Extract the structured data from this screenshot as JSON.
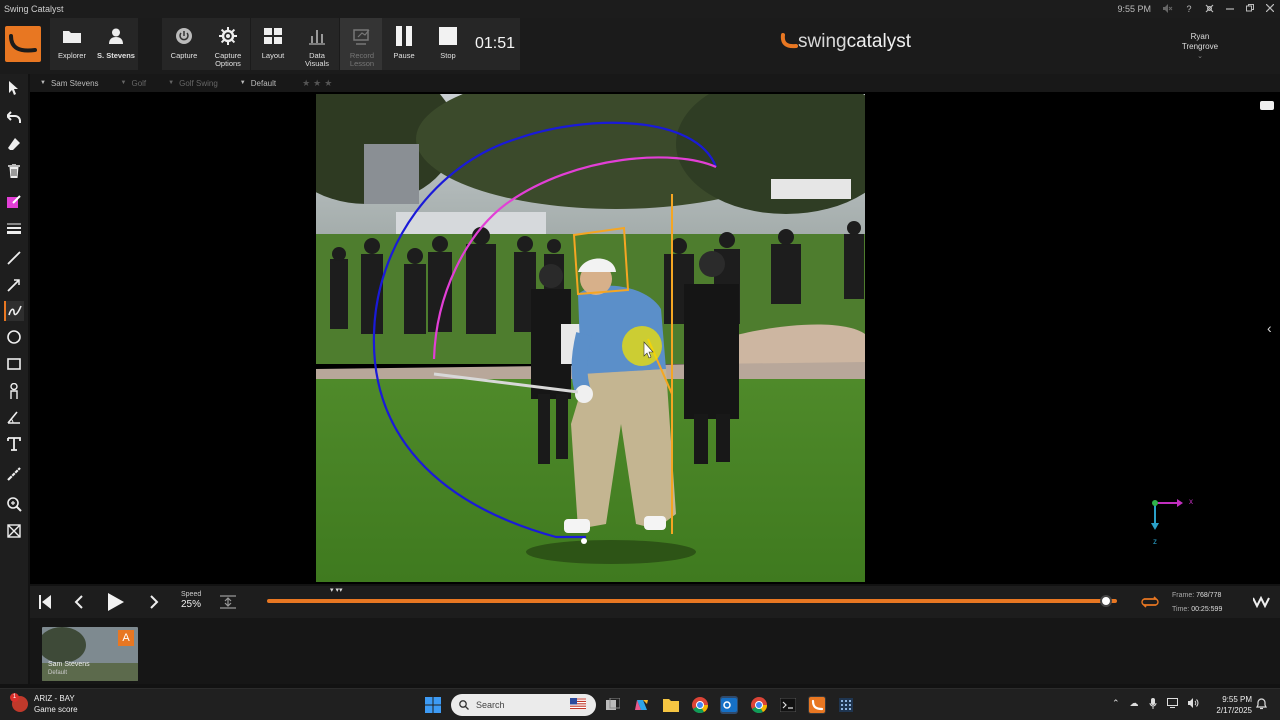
{
  "window": {
    "title": "Swing Catalyst",
    "status_time": "9:55 PM",
    "help": "?"
  },
  "toolbar": {
    "explorer": "Explorer",
    "student": "S. Stevens",
    "capture": "Capture",
    "capture_options_1": "Capture",
    "capture_options_2": "Options",
    "layout": "Layout",
    "data_visuals_1": "Data",
    "data_visuals_2": "Visuals",
    "record_lesson_1": "Record",
    "record_lesson_2": "Lesson",
    "pause": "Pause",
    "stop": "Stop",
    "timer": "01:51"
  },
  "brand": {
    "part1": "swing",
    "part2": "catalyst"
  },
  "user": {
    "first": "Ryan",
    "last": "Trengrove"
  },
  "breadcrumb": {
    "student": "Sam Stevens",
    "sport": "Golf",
    "category": "Golf Swing",
    "layout": "Default",
    "stars": "★★★"
  },
  "playback": {
    "speed_label": "Speed",
    "speed_value": "25%",
    "progress": 0.987,
    "frame_label": "Frame:",
    "frame_value": "768/778",
    "time_label": "Time:",
    "time_value": "00:25:599",
    "markers": "▾ ▾▾"
  },
  "clip": {
    "badge": "A",
    "name": "Sam Stevens",
    "layout": "Default"
  },
  "axes": {
    "x": "x",
    "z": "z"
  },
  "taskbar": {
    "news_title": "ARIZ - BAY",
    "news_sub": "Game score",
    "news_badge": "1",
    "search_placeholder": "Search",
    "time": "9:55 PM",
    "date": "2/17/2025"
  },
  "colors": {
    "accent": "#e87722",
    "drawing_blue": "#1a1ad8",
    "drawing_pink": "#e23fd6",
    "drawing_orange": "#f5a623",
    "pointer_yellow": "#f2e100"
  }
}
